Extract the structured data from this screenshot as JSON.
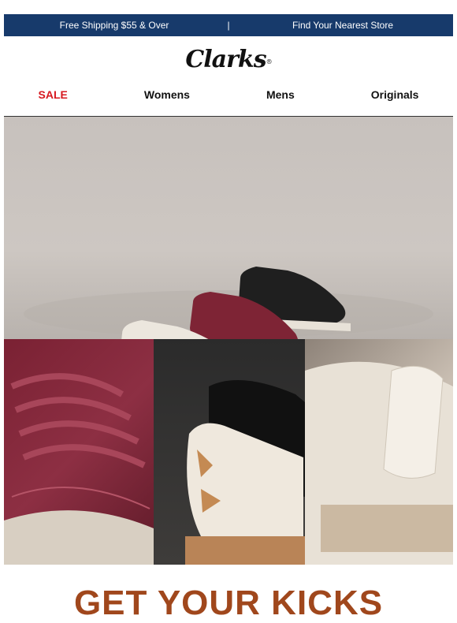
{
  "topbar": {
    "shipping": "Free Shipping $55 & Over",
    "separator": "|",
    "store": "Find Your Nearest Store"
  },
  "brand": {
    "logo": "Clarks",
    "reg": "®"
  },
  "nav": {
    "sale": "SALE",
    "womens": "Womens",
    "mens": "Mens",
    "originals": "Originals"
  },
  "headline": "GET YOUR KICKS",
  "colors": {
    "topbar_bg": "#173a6b",
    "sale_red": "#d71920",
    "headline_rust": "#a0471c"
  }
}
